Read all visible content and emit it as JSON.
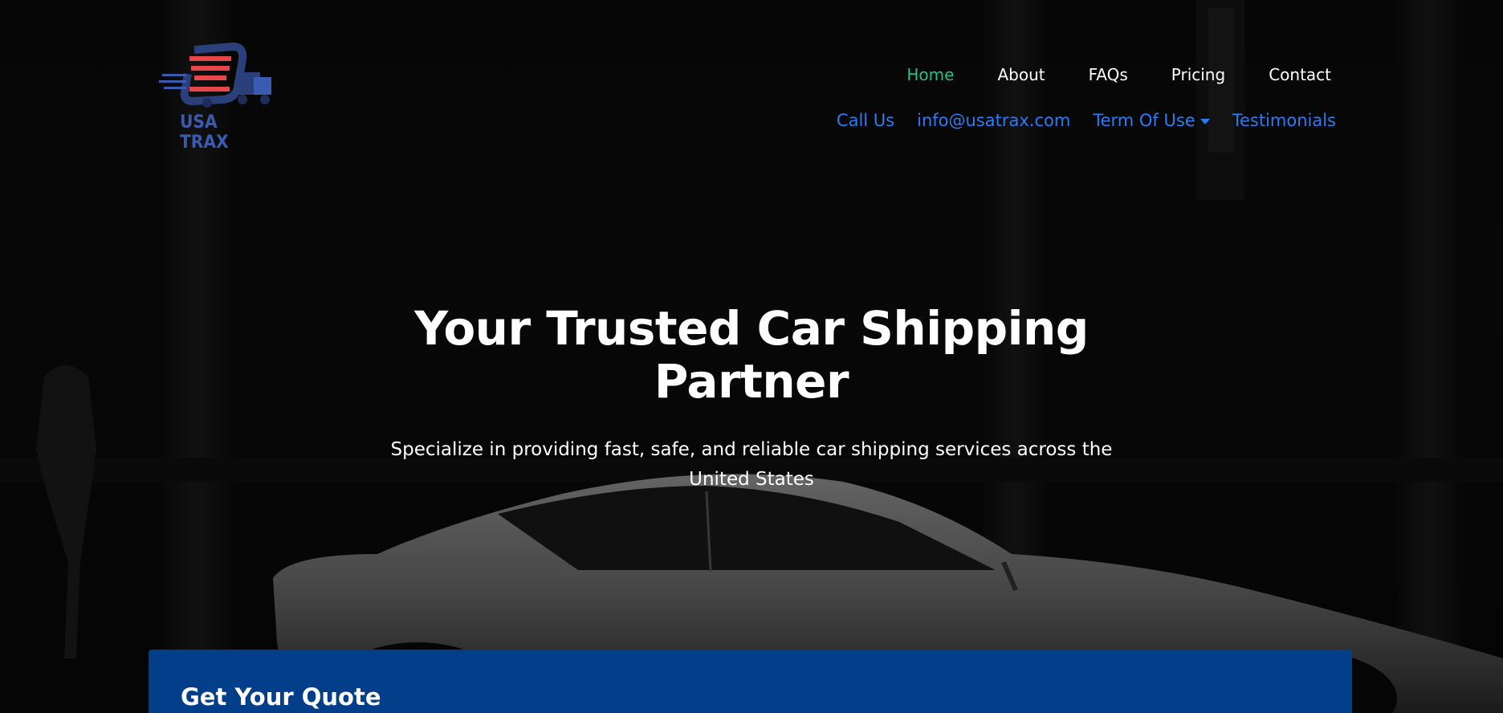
{
  "brand": {
    "name": "USA TRAX"
  },
  "nav": {
    "primary": [
      {
        "label": "Home",
        "active": true
      },
      {
        "label": "About",
        "active": false
      },
      {
        "label": "FAQs",
        "active": false
      },
      {
        "label": "Pricing",
        "active": false
      },
      {
        "label": "Contact",
        "active": false
      }
    ],
    "secondary": [
      {
        "label": "Call Us"
      },
      {
        "label": "info@usatrax.com"
      },
      {
        "label": "Term Of Use",
        "dropdown": true
      },
      {
        "label": "Testimonials"
      }
    ]
  },
  "hero": {
    "headline": "Your Trusted Car Shipping Partner",
    "subtitle": "Specialize in providing fast, safe, and reliable car shipping services across the United States"
  },
  "quote": {
    "title": "Get Your Quote"
  },
  "colors": {
    "nav_active": "#22c08a",
    "nav_link": "#ffffff",
    "secondary_link": "#2a7cf4",
    "quote_panel": "#033e8a",
    "logo_red": "#e8464a",
    "logo_blue": "#3a5bb0"
  },
  "icons": {
    "dropdown": "caret-down-icon"
  }
}
